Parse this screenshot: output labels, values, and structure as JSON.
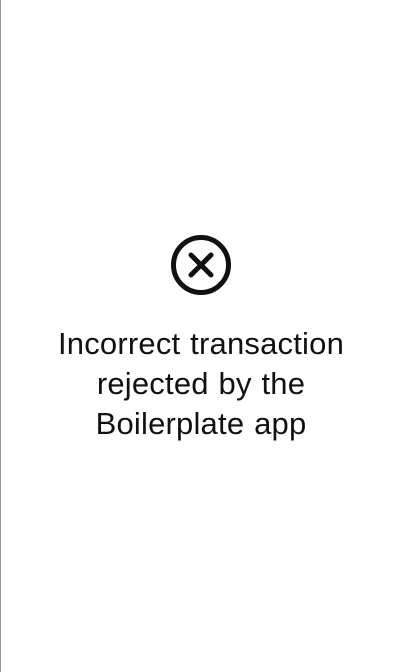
{
  "status": {
    "icon": "close-circle-icon",
    "message_lines": [
      "Incorrect transaction",
      "rejected by the",
      "Boilerplate app"
    ]
  },
  "colors": {
    "background": "#ffffff",
    "text": "#111111",
    "icon": "#111111",
    "left_border": "#9a9a9a"
  }
}
